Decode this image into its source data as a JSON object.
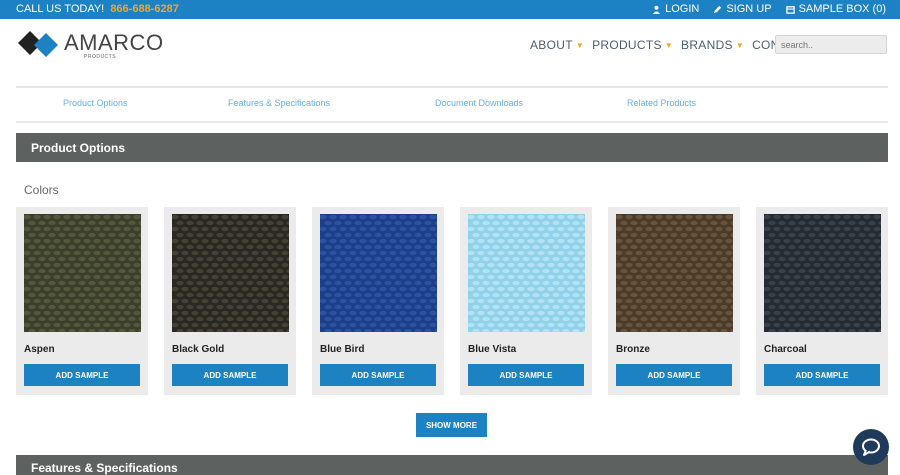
{
  "topbar": {
    "call_label": "CALL US TODAY!",
    "phone": "866-688-6287",
    "login": "LOGIN",
    "signup": "SIGN UP",
    "sample_box": "SAMPLE BOX (0)"
  },
  "logo": {
    "name": "AMARCO",
    "sub": "PRODUCTS"
  },
  "nav": {
    "about": "ABOUT",
    "products": "PRODUCTS",
    "brands": "BRANDS",
    "contact": "CONTACT"
  },
  "search": {
    "placeholder": "search.."
  },
  "subnav": {
    "options": "Product Options",
    "features": "Features & Specifications",
    "documents": "Document Downloads",
    "related": "Related Products"
  },
  "sections": {
    "product_options": "Product Options",
    "features_specs": "Features & Specifications"
  },
  "colors_label": "Colors",
  "add_sample_label": "ADD SAMPLE",
  "show_more_label": "SHOW MORE",
  "swatches": [
    {
      "name": "Aspen",
      "base": "#3b3f2c",
      "stitch": "#5a5e40"
    },
    {
      "name": "Black Gold",
      "base": "#2b2823",
      "stitch": "#4a4537"
    },
    {
      "name": "Blue Bird",
      "base": "#1d3f8a",
      "stitch": "#2f56a6"
    },
    {
      "name": "Blue Vista",
      "base": "#8fd2ea",
      "stitch": "#b8e5f4"
    },
    {
      "name": "Bronze",
      "base": "#4b3b28",
      "stitch": "#6b5a40"
    },
    {
      "name": "Charcoal",
      "base": "#252b33",
      "stitch": "#3d4550"
    }
  ],
  "colors": {
    "topbar": "#1c82c4",
    "accent": "#f5a623",
    "button": "#1d82c1",
    "section_bar": "#5d6261"
  }
}
